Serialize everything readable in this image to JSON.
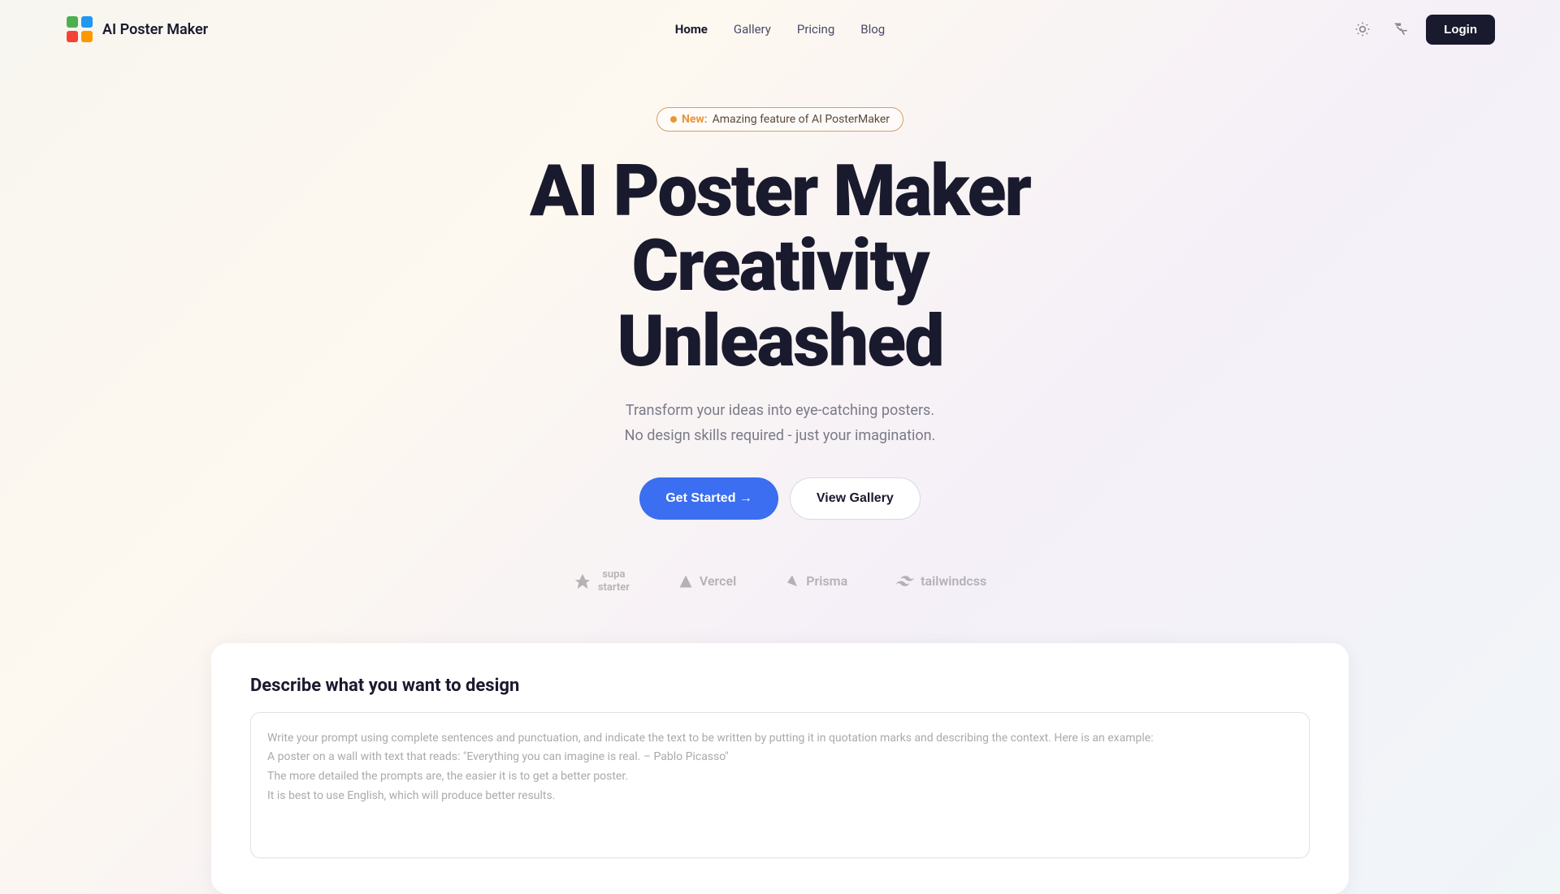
{
  "nav": {
    "logo_text": "AI Poster Maker",
    "links": [
      {
        "label": "Home",
        "active": true
      },
      {
        "label": "Gallery",
        "active": false
      },
      {
        "label": "Pricing",
        "active": false
      },
      {
        "label": "Blog",
        "active": false
      }
    ],
    "login_label": "Login"
  },
  "hero": {
    "badge_new": "New:",
    "badge_text": "Amazing feature of AI PosterMaker",
    "title_line1": "AI Poster Maker",
    "title_line2": "Creativity",
    "title_line3": "Unleashed",
    "subtitle_line1": "Transform your ideas into eye-catching posters.",
    "subtitle_line2": "No design skills required - just your imagination.",
    "btn_start": "Get Started →",
    "btn_gallery": "View Gallery"
  },
  "logos": [
    {
      "name": "supastarter",
      "label": "supa\nstarter"
    },
    {
      "name": "vercel",
      "label": "▲ Vercel"
    },
    {
      "name": "prisma",
      "label": "◇ Prisma"
    },
    {
      "name": "tailwindcss",
      "label": "~ tailwindcss"
    }
  ],
  "design_section": {
    "title": "Describe what you want to design",
    "placeholder": "Write your prompt using complete sentences and punctuation, and indicate the text to be written by putting it in quotation marks and describing the context. Here is an example:\nA poster on a wall with text that reads: \"Everything you can imagine is real. – Pablo Picasso\"\nThe more detailed the prompts are, the easier it is to get a better poster.\nIt is best to use English, which will produce better results."
  }
}
